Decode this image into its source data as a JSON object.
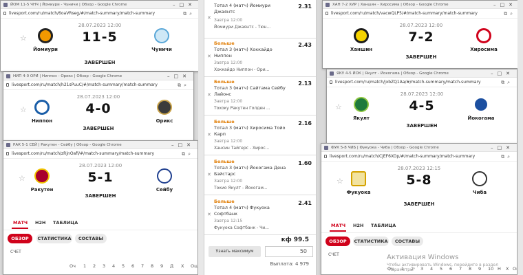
{
  "windows": [
    {
      "title": "ЙОМ 11-5 ЧНЧ | Йомиури - Чуничи | Обзор - Google Chrome",
      "url": "livesport.com/ru/match/6oaVRseg/#/match-summary/match-summary",
      "date": "28.07.2023 12:00",
      "score": "11-5",
      "status": "ЗАВЕРШЕН",
      "home": {
        "name": "Йомиури",
        "color": "#f39800"
      },
      "away": {
        "name": "Чуничи",
        "color": "#5aa7d8"
      }
    },
    {
      "title": "НИП 4-0 ОРИ | Ниппон - Орикс | Обзор - Google Chrome",
      "url": "livesport.com/ru/match/h21sPuuC/#/match-summary/match-summary",
      "date": "28.07.2023 12:00",
      "score": "4-0",
      "status": "ЗАВЕРШЕН",
      "home": {
        "name": "Ниппон",
        "color": "#1a5ea8"
      },
      "away": {
        "name": "Орикс",
        "color": "#3b3b3b"
      }
    },
    {
      "title": "РАК 5-1 СЕЙ | Ракутен - Сейбу | Обзор - Google Chrome",
      "url": "livesport.com/ru/match/zRjnOafi/#/match-summary/match-summary",
      "date": "28.07.2023 12:00",
      "score": "5-1",
      "status": "ЗАВЕРШЕН",
      "home": {
        "name": "Ракутен",
        "color": "#a8002d"
      },
      "away": {
        "name": "Сейбу",
        "color": "#1f3f8f"
      }
    },
    {
      "title": "ХАН 7-2 ХИР | Ханшин - Хиросима | Обзор - Google Chrome",
      "url": "livesport.com/ru/match/vacwQLP5/#/match-summary/match-summary",
      "date": "28.07.2023 12:00",
      "score": "7-2",
      "status": "ЗАВЕРШЕН",
      "home": {
        "name": "Ханшин",
        "color": "#1b1b1b"
      },
      "away": {
        "name": "Хиросима",
        "color": "#d0021b"
      }
    },
    {
      "title": "ЯКУ 4-5 ЙОК | Якулт - Йокогама | Обзор - Google Chrome",
      "url": "livesport.com/ru/match/jxbZQ1Aa/#/match-summary/match-summary",
      "date": "28.07.2023 12:00",
      "score": "4-5",
      "status": "ЗАВЕРШЕН",
      "home": {
        "name": "Якулт",
        "color": "#1e7a3c"
      },
      "away": {
        "name": "Йокогама",
        "color": "#1c4fa0"
      }
    },
    {
      "title": "ФУК 5-8 ЧИБ | Фукуока - Чиба | Обзор - Google Chrome",
      "url": "livesport.com/ru/match/CjEF6XOp/#/match-summary/match-summary",
      "date": "28.07.2023 12:15",
      "score": "5-8",
      "status": "ЗАВЕРШЕН",
      "home": {
        "name": "Фукуока",
        "color": "#d4a200"
      },
      "away": {
        "name": "Чиба",
        "color": "#333333"
      }
    }
  ],
  "tabs": {
    "match": "МАТЧ",
    "h2h": "H2H",
    "table": "ТАБЛИЦА"
  },
  "subtabs": {
    "overview": "ОБЗОР",
    "stats": "СТАТИСТИКА",
    "lineups": "СОСТАВЫ"
  },
  "score_section": "СЧЕТ",
  "columns": [
    "Оч",
    "1",
    "2",
    "3",
    "4",
    "5",
    "6",
    "7",
    "8",
    "9",
    "10",
    "Д",
    "Н",
    "Х",
    "Ош"
  ],
  "betslip": {
    "bets": [
      {
        "label": "Больше",
        "desc": "Тотал 4 (матч) Йомиури Джаянтс",
        "when": "Завтра 12:00",
        "teams": "Йомиури Джаянтс - Тюн...",
        "odd": "2.31"
      },
      {
        "label": "Больше",
        "desc": "Тотал 3 (матч) Хоккайдо Ниппон",
        "when": "Завтра 12:00",
        "teams": "Хоккайдо Ниппон - Ори...",
        "odd": "2.43"
      },
      {
        "label": "Больше",
        "desc": "Тотал 3 (матч) Сайтама Сейбу Лайонс",
        "when": "Завтра 12:00",
        "teams": "Тохоку Ракутен Голден ...",
        "odd": "2.13"
      },
      {
        "label": "Больше",
        "desc": "Тотал 3 (матч) Хиросима Тойо Карп",
        "when": "Завтра 12:00",
        "teams": "Хансин Тайгерс - Хирос...",
        "odd": "2.16"
      },
      {
        "label": "Больше",
        "desc": "Тотал 3 (матч) Йокогама Дена Бэйстарс",
        "when": "Завтра 12:00",
        "teams": "Токио Якулт - Йокогам...",
        "odd": "1.60"
      },
      {
        "label": "Больше",
        "desc": "Тотал 4 (матч) Фукуока Софтбанк",
        "when": "Завтра 12:15",
        "teams": "Фукуока Софтбанк - Чи...",
        "odd": "2.41"
      }
    ],
    "kf": "кф 99.5",
    "max_button": "Узнать максимум",
    "stake": "50",
    "payout": "Выплата: 4 979"
  },
  "activation": {
    "title": "Активация Windows",
    "text": "Чтобы активировать Windows, перейдите в раздел \"Параметры\""
  }
}
